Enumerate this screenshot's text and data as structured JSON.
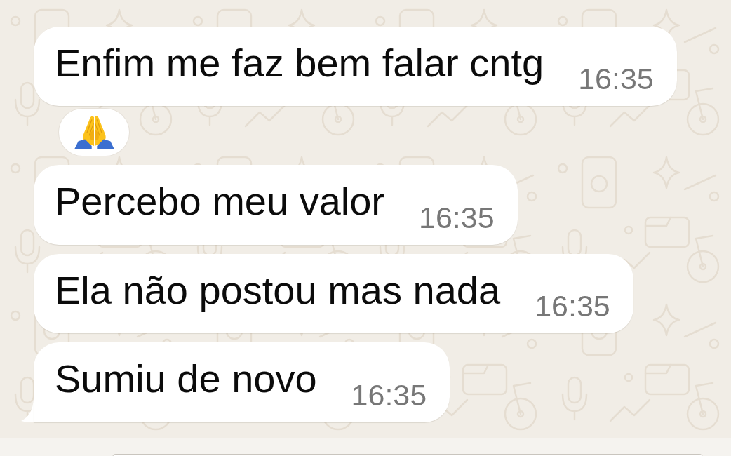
{
  "messages": [
    {
      "text": "Enfim me faz bem falar cntg",
      "time": "16:35",
      "reacted": true,
      "tail": false
    },
    {
      "text": "Percebo meu valor",
      "time": "16:35",
      "reacted": false,
      "tail": false
    },
    {
      "text": "Ela não postou mas nada",
      "time": "16:35",
      "reacted": false,
      "tail": false
    },
    {
      "text": "Sumiu de novo",
      "time": "16:35",
      "reacted": false,
      "tail": true
    }
  ]
}
